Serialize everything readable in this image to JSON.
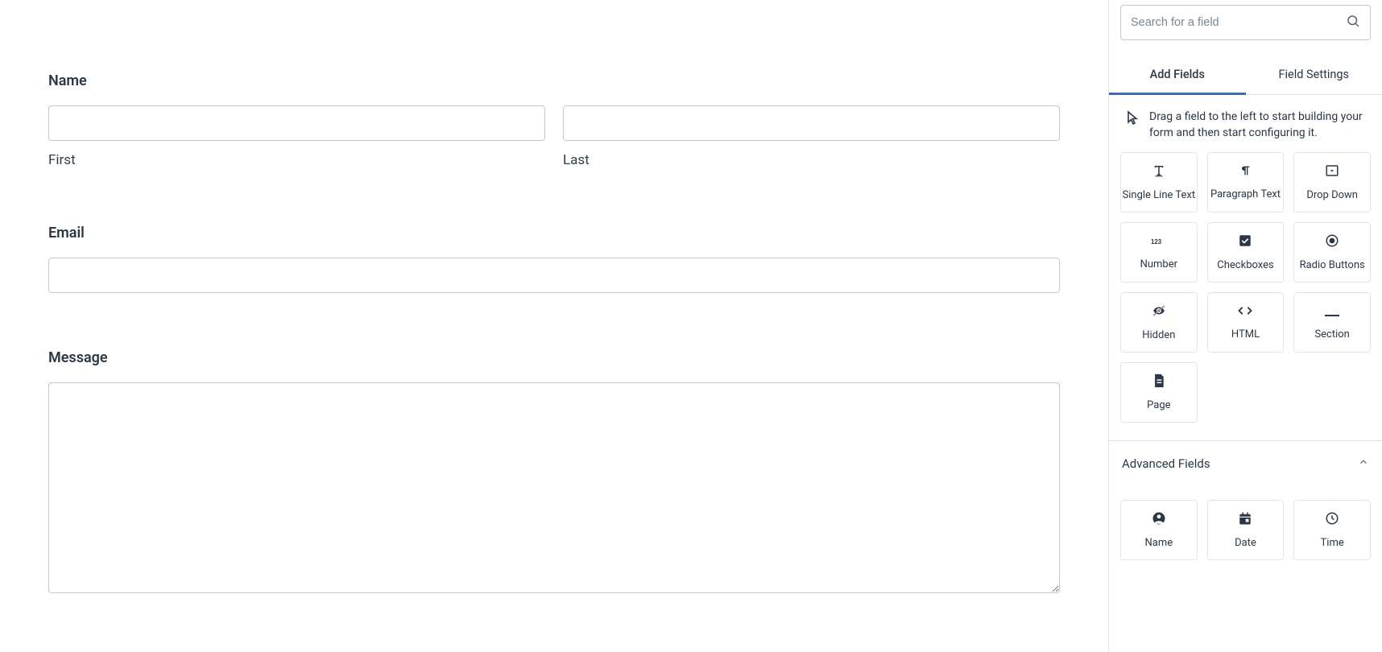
{
  "form": {
    "name_label": "Name",
    "first_sublabel": "First",
    "last_sublabel": "Last",
    "email_label": "Email",
    "message_label": "Message"
  },
  "sidebar": {
    "search_placeholder": "Search for a field",
    "tabs": {
      "add_fields": "Add Fields",
      "field_settings": "Field Settings"
    },
    "instruction": "Drag a field to the left to start building your form and then start configuring it.",
    "standard_fields": [
      {
        "key": "single_line_text",
        "label": "Single Line Text"
      },
      {
        "key": "paragraph_text",
        "label": "Paragraph Text"
      },
      {
        "key": "drop_down",
        "label": "Drop Down"
      },
      {
        "key": "number",
        "label": "Number"
      },
      {
        "key": "checkboxes",
        "label": "Checkboxes"
      },
      {
        "key": "radio_buttons",
        "label": "Radio Buttons"
      },
      {
        "key": "hidden",
        "label": "Hidden"
      },
      {
        "key": "html",
        "label": "HTML"
      },
      {
        "key": "section",
        "label": "Section"
      },
      {
        "key": "page",
        "label": "Page"
      }
    ],
    "advanced_title": "Advanced Fields",
    "advanced_fields": [
      {
        "key": "name",
        "label": "Name"
      },
      {
        "key": "date",
        "label": "Date"
      },
      {
        "key": "time",
        "label": "Time"
      }
    ]
  }
}
